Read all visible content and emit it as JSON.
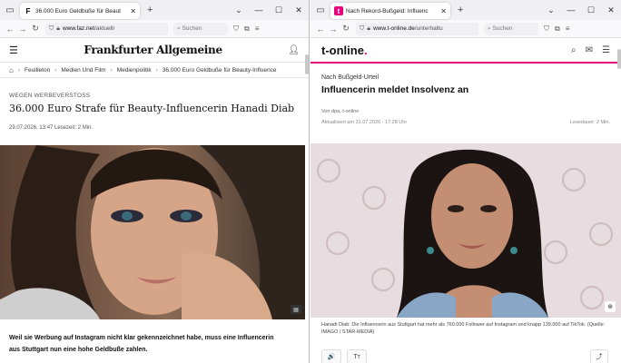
{
  "left": {
    "tab": {
      "favicon": "F",
      "title": "36.000 Euro Geldbuße für Beaut"
    },
    "url": {
      "host": "www.faz.net",
      "path": "/aktuell/"
    },
    "search_placeholder": "Suchen",
    "logo": "Frankfurter Allgemeine",
    "breadcrumbs": [
      "Feuilleton",
      "Medien Und Film",
      "Medienpolitik",
      "36.000 Euro Geldbuße für Beauty-Influence"
    ],
    "kicker": "WEGEN WERBEVERSTOSS",
    "title": "36.000 Euro Strafe für Beauty-Influencerin Hanadi Diab",
    "meta": "29.07.2026, 13:47   Lesezeit: 2 Min.",
    "lead": "Weil sie Werbung auf Instagram nicht klar gekennzeichnet habe, muss eine Influencerin aus Stuttgart nun eine hohe Geldbuße zahlen."
  },
  "right": {
    "tab": {
      "favicon": "t",
      "title": "Nach Rekord-Bußgeld: Influenc"
    },
    "url": {
      "host": "www.t-online.de",
      "path": "/unterhaltu"
    },
    "search_placeholder": "Suchen",
    "logo_text": "t-online",
    "logo_dot": ".",
    "kicker": "Nach Bußgeld-Urteil",
    "title": "Influencerin meldet Insolvenz an",
    "author": "Von dpa, t-online",
    "updated": "Aktualisiert am 31.07.2026 - 17:28 Uhr",
    "reading_time": "Lesedauer: 2 Min.",
    "caption": "Hanadi Diab: Die Influencerin aus Stuttgart hat mehr als 760.000 Follower auf Instagram und knapp 139.000 auf TikTok. (Quelle: IMAGO / STAR-MEDIA)",
    "tools": [
      "🔊",
      "Tт"
    ]
  },
  "colors": {
    "brand_tonline": "#e6007e",
    "chrome_bg": "#f0f0f4"
  },
  "icons": [
    "tabs-icon",
    "back-icon",
    "forward-icon",
    "reload-icon",
    "shield-icon",
    "lock-icon",
    "extensions-icon",
    "menu-icon",
    "user-icon",
    "home-icon",
    "search-icon",
    "mail-icon",
    "zoom-icon",
    "share-icon",
    "speaker-icon",
    "text-size-icon"
  ]
}
